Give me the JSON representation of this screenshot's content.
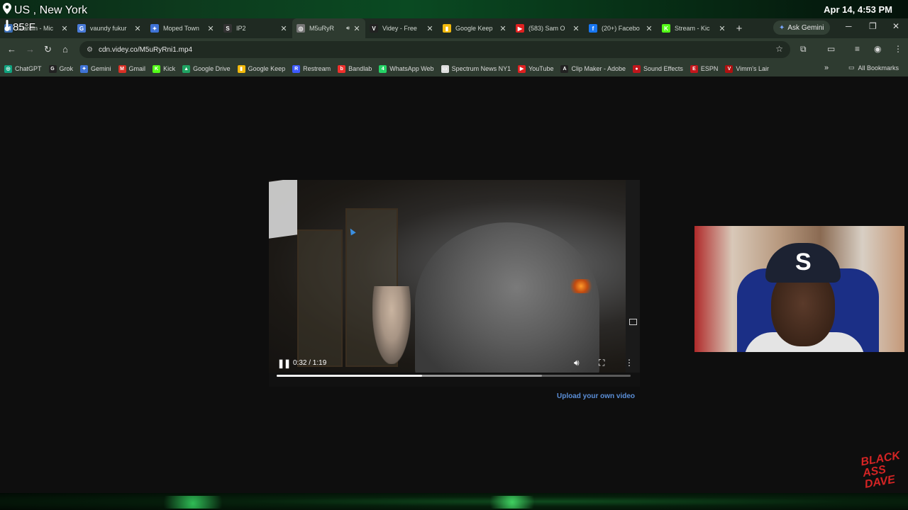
{
  "overlay": {
    "location": "US , New York",
    "temperature": "85°F",
    "datetime": "Apr 14, 4:53 PM"
  },
  "tabs": [
    {
      "title": "Giardin - Mic",
      "icon": "microsoft-icon",
      "color": "#3a6db5",
      "glyph": "M"
    },
    {
      "title": "vaundy fukur",
      "icon": "google-icon",
      "color": "#4a7bd8",
      "glyph": "G"
    },
    {
      "title": "Moped Town",
      "icon": "gemini-star-icon",
      "color": "#3f73d6",
      "glyph": "✦"
    },
    {
      "title": "IP2",
      "icon": "ip2-icon",
      "color": "#333333",
      "glyph": "S"
    },
    {
      "title": "M5uRyR",
      "icon": "globe-icon",
      "color": "#777777",
      "glyph": "◎",
      "active": true
    },
    {
      "title": "Videy - Free",
      "icon": "videy-icon",
      "color": "#222222",
      "glyph": "V"
    },
    {
      "title": "Google Keep",
      "icon": "keep-icon",
      "color": "#f2b90c",
      "glyph": "▮"
    },
    {
      "title": "(583) Sam O",
      "icon": "youtube-icon",
      "color": "#e02020",
      "glyph": "▶"
    },
    {
      "title": "(20+) Facebo",
      "icon": "facebook-icon",
      "color": "#1877f2",
      "glyph": "f"
    },
    {
      "title": "Stream - Kic",
      "icon": "kick-icon",
      "color": "#53fc18",
      "glyph": "K"
    }
  ],
  "ask_gemini": "Ask Gemini",
  "address": {
    "url": "cdn.videy.co/M5uRyRni1.mp4"
  },
  "bookmarks": [
    {
      "label": "ChatGPT",
      "icon": "chatgpt-icon",
      "color": "#10a37f",
      "glyph": "◎"
    },
    {
      "label": "Grok",
      "icon": "grok-icon",
      "color": "#222222",
      "glyph": "G"
    },
    {
      "label": "Gemini",
      "icon": "gemini-star-icon",
      "color": "#3f73d6",
      "glyph": "✦"
    },
    {
      "label": "Gmail",
      "icon": "gmail-icon",
      "color": "#d93025",
      "glyph": "M"
    },
    {
      "label": "Kick",
      "icon": "kick-icon",
      "color": "#53fc18",
      "glyph": "K"
    },
    {
      "label": "Google Drive",
      "icon": "drive-icon",
      "color": "#1fa463",
      "glyph": "▲"
    },
    {
      "label": "Google Keep",
      "icon": "keep-icon",
      "color": "#f2b90c",
      "glyph": "▮"
    },
    {
      "label": "Restream",
      "icon": "restream-icon",
      "color": "#3d5afe",
      "glyph": "R"
    },
    {
      "label": "Bandlab",
      "icon": "bandlab-icon",
      "color": "#f0302c",
      "glyph": "b"
    },
    {
      "label": "WhatsApp Web",
      "icon": "whatsapp-icon",
      "color": "#25d366",
      "glyph": "4"
    },
    {
      "label": "Spectrum News NY1",
      "icon": "spectrum-icon",
      "color": "#dddddd",
      "glyph": "▭"
    },
    {
      "label": "YouTube",
      "icon": "youtube-icon",
      "color": "#e02020",
      "glyph": "▶"
    },
    {
      "label": "Clip Maker - Adobe",
      "icon": "adobe-icon",
      "color": "#222222",
      "glyph": "A"
    },
    {
      "label": "Sound Effects",
      "icon": "sound-effects-icon",
      "color": "#c0161c",
      "glyph": "●"
    },
    {
      "label": "ESPN",
      "icon": "espn-icon",
      "color": "#c4161c",
      "glyph": "E"
    },
    {
      "label": "Vimm's Lair",
      "icon": "vimms-icon",
      "color": "#b01010",
      "glyph": "V"
    }
  ],
  "all_bookmarks": "All Bookmarks",
  "player": {
    "time": "0:32 / 1:19",
    "progress_fraction": 0.41,
    "buffered_fraction": 0.75
  },
  "upload_link": "Upload your own video",
  "watermark": "BLACK ASS DAVE"
}
